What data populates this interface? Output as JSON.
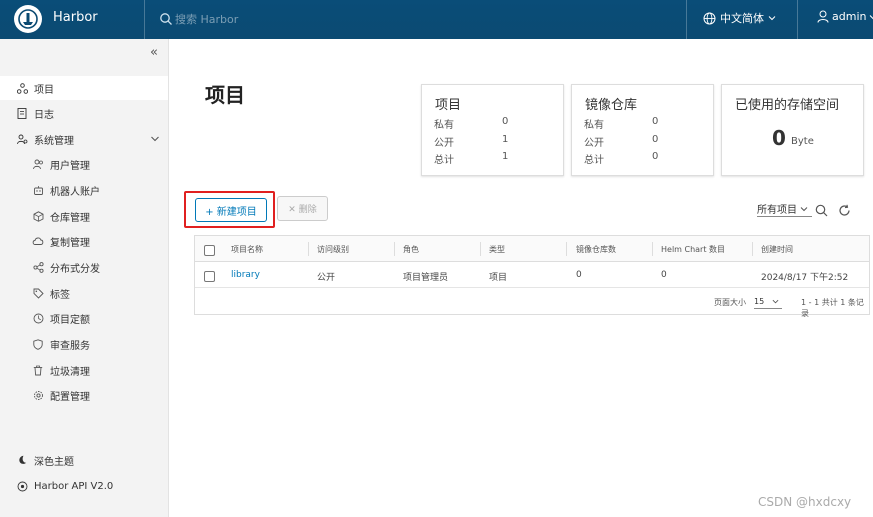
{
  "header": {
    "brand": "Harbor",
    "search_placeholder": "搜索 Harbor",
    "language": "中文简体",
    "user": "admin"
  },
  "sidebar": {
    "items": [
      {
        "label": "项目",
        "icon": "projects-icon",
        "active": true
      },
      {
        "label": "日志",
        "icon": "logs-icon"
      },
      {
        "label": "系统管理",
        "icon": "admin-icon"
      },
      {
        "label": "用户管理",
        "icon": "users-icon"
      },
      {
        "label": "机器人账户",
        "icon": "robot-icon"
      },
      {
        "label": "仓库管理",
        "icon": "registry-icon"
      },
      {
        "label": "复制管理",
        "icon": "replication-icon"
      },
      {
        "label": "分布式分发",
        "icon": "distribution-icon"
      },
      {
        "label": "标签",
        "icon": "tag-icon"
      },
      {
        "label": "项目定额",
        "icon": "quota-icon"
      },
      {
        "label": "审查服务",
        "icon": "shield-icon"
      },
      {
        "label": "垃圾清理",
        "icon": "trash-icon"
      },
      {
        "label": "配置管理",
        "icon": "gear-icon"
      }
    ],
    "theme": "深色主题",
    "api": "Harbor API V2.0"
  },
  "page_title": "项目",
  "cards": {
    "projects": {
      "title": "项目",
      "private_label": "私有",
      "private": "0",
      "public_label": "公开",
      "public": "1",
      "total_label": "总计",
      "total": "1"
    },
    "repos": {
      "title": "镜像仓库",
      "private_label": "私有",
      "private": "0",
      "public_label": "公开",
      "public": "0",
      "total_label": "总计",
      "total": "0"
    },
    "storage": {
      "title": "已使用的存储空间",
      "value": "0",
      "unit": "Byte"
    }
  },
  "toolbar": {
    "new_project": "+ 新建项目",
    "delete": "✕ 删除",
    "filter": "所有项目"
  },
  "table": {
    "headers": [
      "项目名称",
      "访问级别",
      "角色",
      "类型",
      "镜像仓库数",
      "Helm Chart 数目",
      "创建时间"
    ],
    "rows": [
      [
        "library",
        "公开",
        "项目管理员",
        "项目",
        "0",
        "0",
        "2024/8/17 下午2:52"
      ]
    ],
    "page_size_label": "页面大小",
    "page_size": "15",
    "summary": "1 - 1 共计 1 条记录"
  },
  "watermark": "CSDN @hxdcxy"
}
